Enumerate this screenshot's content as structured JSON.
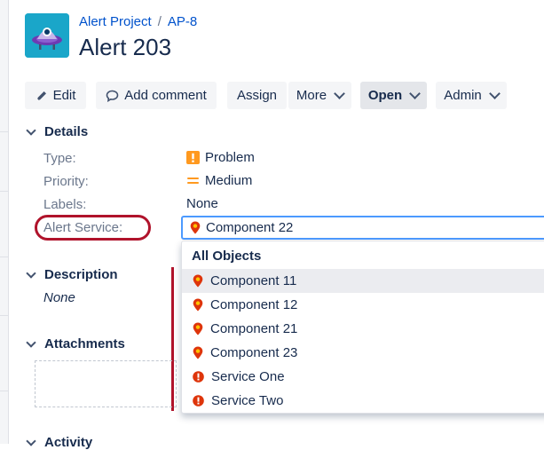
{
  "breadcrumb": {
    "project": "Alert Project",
    "separator": "/",
    "issue_key": "AP-8"
  },
  "issue": {
    "title": "Alert 203"
  },
  "toolbar": {
    "edit": "Edit",
    "add_comment": "Add comment",
    "assign": "Assign",
    "more": "More",
    "open": "Open",
    "admin": "Admin"
  },
  "details": {
    "heading": "Details",
    "fields": [
      {
        "label": "Type:",
        "value": "Problem",
        "icon": "exclamation-square-icon",
        "color": "#ff991f"
      },
      {
        "label": "Priority:",
        "value": "Medium",
        "icon": "priority-medium-icon",
        "color": "#ff991f"
      },
      {
        "label": "Labels:",
        "value": "None"
      },
      {
        "label": "Alert Service:",
        "value": "Component 22",
        "icon": "map-pin-icon"
      }
    ]
  },
  "dropdown": {
    "heading": "All Objects",
    "items": [
      {
        "label": "Component 11",
        "icon": "map-pin-icon",
        "selected": true
      },
      {
        "label": "Component 12",
        "icon": "map-pin-icon"
      },
      {
        "label": "Component 21",
        "icon": "map-pin-icon"
      },
      {
        "label": "Component 23",
        "icon": "map-pin-icon"
      },
      {
        "label": "Service One",
        "icon": "alert-circle-icon"
      },
      {
        "label": "Service Two",
        "icon": "alert-circle-icon"
      }
    ]
  },
  "description": {
    "heading": "Description",
    "value": "None"
  },
  "attachments": {
    "heading": "Attachments"
  },
  "activity": {
    "heading": "Activity"
  },
  "colors": {
    "link": "#0052cc",
    "annotation": "#b0132b",
    "focus": "#4c9aff",
    "pin": "#de350b"
  }
}
